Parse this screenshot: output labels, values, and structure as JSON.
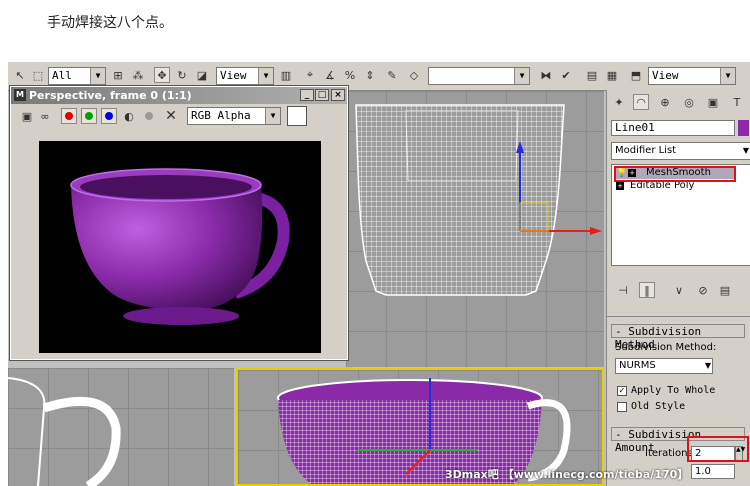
{
  "caption": "手动焊接这八个点。",
  "toolbar": {
    "selection_filter": "All",
    "ref_coord": "View",
    "named_selection": "",
    "view_combo": "View"
  },
  "render_window": {
    "title": "Perspective, frame 0 (1:1)",
    "channel": "RGB Alpha",
    "btn_min": "_",
    "btn_max": "□",
    "btn_close": "×"
  },
  "panel": {
    "object_name": "Line01",
    "modifier_list": "Modifier List",
    "stack": [
      "MeshSmooth",
      "Editable Poly"
    ],
    "subdivision_method_header": "Subdivision Method",
    "subdivision_method_label": "Subdivision Method:",
    "subdivision_method_value": "NURMS",
    "apply_to_whole": "Apply To Whole",
    "old_style": "Old Style",
    "subdivision_amount_header": "Subdivision Amount",
    "iterations_label": "Iterations:",
    "iterations_value": "2",
    "smoothness_value": "1.0"
  },
  "watermark": "3Dmax吧 【www.linecg.com/tieba/170】",
  "colors": {
    "purple": "#8a2aa8",
    "red_highlight": "#e0101a",
    "window_gray": "#d4d0c8"
  }
}
